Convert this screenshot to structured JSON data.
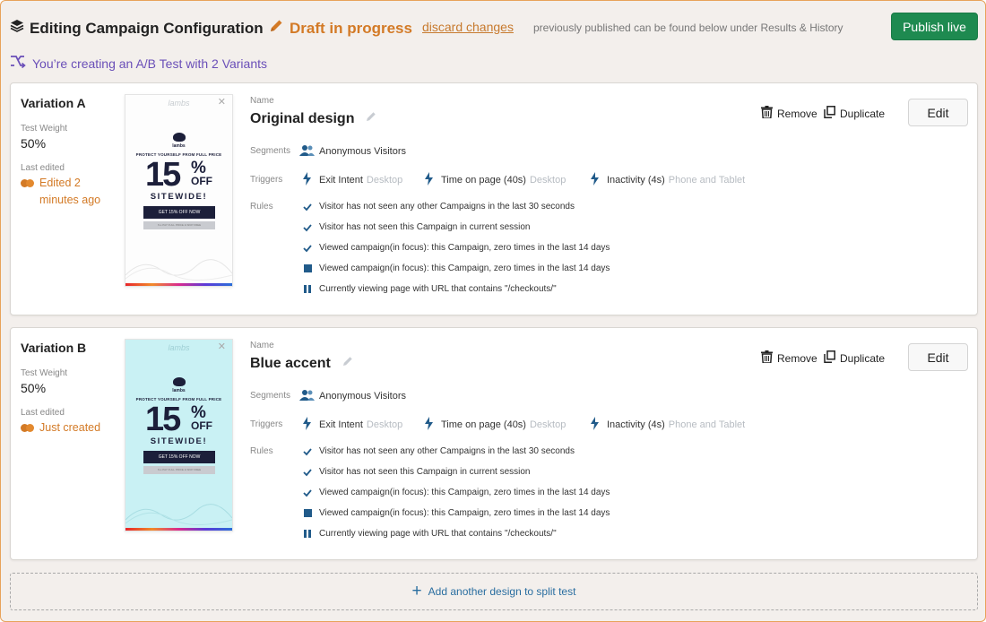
{
  "header": {
    "title": "Editing Campaign Configuration",
    "draft_status": "Draft in progress",
    "discard_label": "discard changes",
    "note": "previously published can be found below under Results & History",
    "publish_label": "Publish live"
  },
  "ab_message": "You’re creating an A/B Test with 2 Variants",
  "labels": {
    "test_weight": "Test Weight",
    "last_edited": "Last edited",
    "name": "Name",
    "segments": "Segments",
    "triggers": "Triggers",
    "rules": "Rules",
    "remove": "Remove",
    "duplicate": "Duplicate",
    "edit": "Edit"
  },
  "variations": [
    {
      "title": "Variation A",
      "weight": "50%",
      "edited": "Edited 2 minutes ago",
      "name": "Original design",
      "thumb_theme": "white",
      "segment": "Anonymous Visitors",
      "triggers": [
        {
          "label": "Exit Intent",
          "device": "Desktop"
        },
        {
          "label": "Time on page (40s)",
          "device": "Desktop"
        },
        {
          "label": "Inactivity (4s)",
          "device": "Phone and Tablet"
        }
      ],
      "rules": [
        {
          "icon": "check",
          "text": "Visitor has not seen any other Campaigns in the last 30 seconds"
        },
        {
          "icon": "check",
          "text": "Visitor has not seen this Campaign in current session"
        },
        {
          "icon": "check",
          "text": "Viewed campaign(in focus): this Campaign, zero times in the last 14 days"
        },
        {
          "icon": "square",
          "text": "Viewed campaign(in focus): this Campaign, zero times in the last 14 days"
        },
        {
          "icon": "pause",
          "text": "Currently viewing page with URL that contains \"/checkouts/\""
        }
      ]
    },
    {
      "title": "Variation B",
      "weight": "50%",
      "edited": "Just created",
      "name": "Blue accent",
      "thumb_theme": "blue",
      "segment": "Anonymous Visitors",
      "triggers": [
        {
          "label": "Exit Intent",
          "device": "Desktop"
        },
        {
          "label": "Time on page (40s)",
          "device": "Desktop"
        },
        {
          "label": "Inactivity (4s)",
          "device": "Phone and Tablet"
        }
      ],
      "rules": [
        {
          "icon": "check",
          "text": "Visitor has not seen any other Campaigns in the last 30 seconds"
        },
        {
          "icon": "check",
          "text": "Visitor has not seen this Campaign in current session"
        },
        {
          "icon": "check",
          "text": "Viewed campaign(in focus): this Campaign, zero times in the last 14 days"
        },
        {
          "icon": "square",
          "text": "Viewed campaign(in focus): this Campaign, zero times in the last 14 days"
        },
        {
          "icon": "pause",
          "text": "Currently viewing page with URL that contains \"/checkouts/\""
        }
      ]
    }
  ],
  "thumbnail": {
    "brand": "lambs",
    "logo_text": "lambs",
    "tagline": "PROTECT YOURSELF FROM FULL PRICE",
    "big_number": "15",
    "percent": "%",
    "off": "OFF",
    "sitewide": "SITEWIDE!",
    "cta": "GET 15% OFF NOW",
    "secondary": "I'LL PAY FULL PRICE & SKIP FREE"
  },
  "add_design_label": "Add another design to split test",
  "colors": {
    "accent_orange": "#d37a26",
    "publish_green": "#1e8a50",
    "ab_purple": "#6a4fb8",
    "icon_blue": "#215b8a",
    "thumb_blue": "#c9f1f4"
  }
}
